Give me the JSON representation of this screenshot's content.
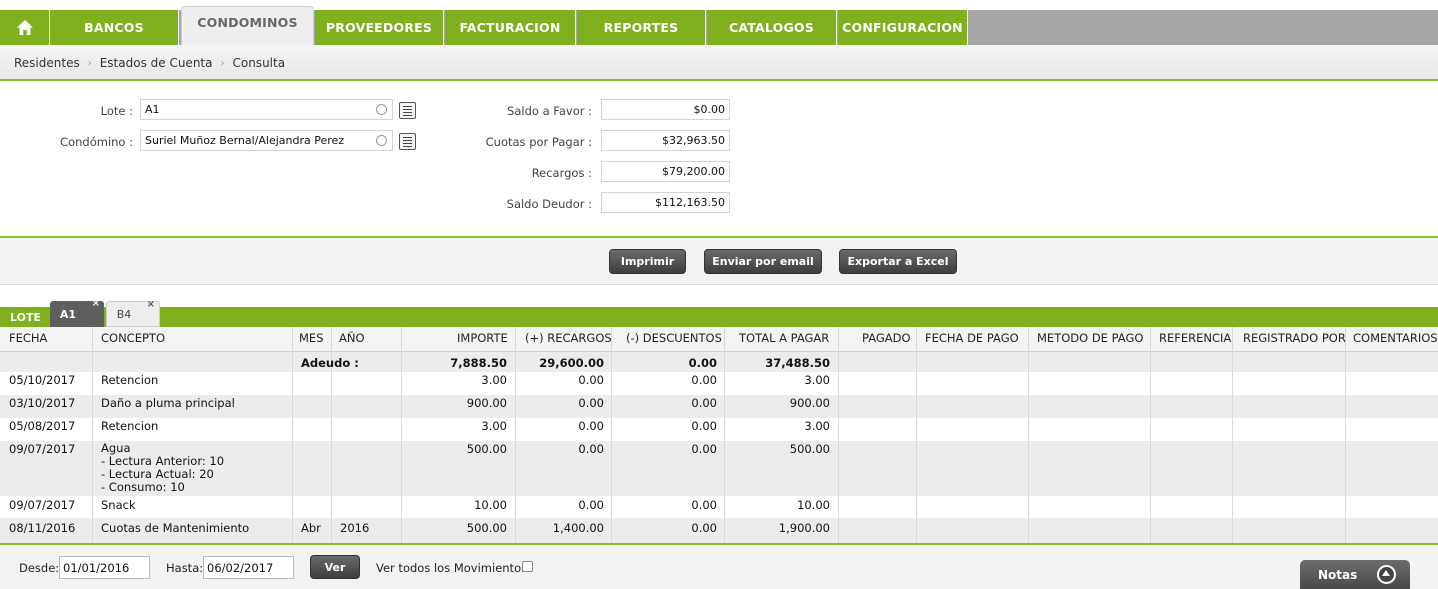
{
  "nav": {
    "home_icon": "home-icon",
    "tabs": [
      "BANCOS",
      "CONDOMINOS",
      "PROVEEDORES",
      "FACTURACION",
      "REPORTES",
      "CATALOGOS",
      "CONFIGURACION"
    ],
    "active": "CONDOMINOS"
  },
  "breadcrumb": [
    "Residentes",
    "Estados de Cuenta",
    "Consulta"
  ],
  "form": {
    "lote_label": "Lote :",
    "lote_value": "A1",
    "condomino_label": "Condómino :",
    "condomino_value": "Suriel Muñoz Bernal/Alejandra Perez",
    "saldo_favor_label": "Saldo a Favor :",
    "saldo_favor_value": "$0.00",
    "cuotas_label": "Cuotas por Pagar :",
    "cuotas_value": "$32,963.50",
    "recargos_label": "Recargos :",
    "recargos_value": "$79,200.00",
    "saldo_deudor_label": "Saldo Deudor :",
    "saldo_deudor_value": "$112,163.50"
  },
  "actions": {
    "imprimir": "Imprimir",
    "enviar": "Enviar por email",
    "exportar": "Exportar a Excel"
  },
  "tabs": {
    "label": "LOTE",
    "items": [
      {
        "label": "A1",
        "close": "×"
      },
      {
        "label": "B4",
        "close": "×"
      }
    ]
  },
  "table": {
    "headers": [
      "FECHA",
      "CONCEPTO",
      "MES",
      "AÑO",
      "IMPORTE",
      "(+) RECARGOS",
      "(-) DESCUENTOS",
      "TOTAL A PAGAR",
      "PAGADO",
      "FECHA DE PAGO",
      "METODO DE PAGO",
      "REFERENCIA",
      "REGISTRADO POR",
      "COMENTARIOS"
    ],
    "adeudo": {
      "label": "Adeudo :",
      "importe": "7,888.50",
      "recargos": "29,600.00",
      "descuentos": "0.00",
      "total": "37,488.50"
    },
    "rows": [
      {
        "fecha": "05/10/2017",
        "concepto": "Retencion",
        "mes": "",
        "anio": "",
        "importe": "3.00",
        "recargos": "0.00",
        "descuentos": "0.00",
        "total": "3.00"
      },
      {
        "fecha": "03/10/2017",
        "concepto": "Daño a pluma principal",
        "mes": "",
        "anio": "",
        "importe": "900.00",
        "recargos": "0.00",
        "descuentos": "0.00",
        "total": "900.00"
      },
      {
        "fecha": "05/08/2017",
        "concepto": "Retencion",
        "mes": "",
        "anio": "",
        "importe": "3.00",
        "recargos": "0.00",
        "descuentos": "0.00",
        "total": "3.00"
      },
      {
        "fecha": "09/07/2017",
        "concepto": "Agua",
        "detalle": [
          "- Lectura Anterior: 10",
          "- Lectura Actual: 20",
          "- Consumo: 10"
        ],
        "mes": "",
        "anio": "",
        "importe": "500.00",
        "recargos": "0.00",
        "descuentos": "0.00",
        "total": "500.00"
      },
      {
        "fecha": "09/07/2017",
        "concepto": "Snack",
        "mes": "",
        "anio": "",
        "importe": "10.00",
        "recargos": "0.00",
        "descuentos": "0.00",
        "total": "10.00"
      },
      {
        "fecha": "08/11/2016",
        "concepto": "Cuotas de Mantenimiento",
        "mes": "Abr",
        "anio": "2016",
        "importe": "500.00",
        "recargos": "1,400.00",
        "descuentos": "0.00",
        "total": "1,900.00"
      }
    ]
  },
  "footer": {
    "desde_label": "Desde:",
    "desde_value": "01/01/2016",
    "hasta_label": "Hasta:",
    "hasta_value": "06/02/2017",
    "ver_label": "Ver",
    "todos_label": "Ver todos los Movimientos",
    "notas_label": "Notas"
  }
}
